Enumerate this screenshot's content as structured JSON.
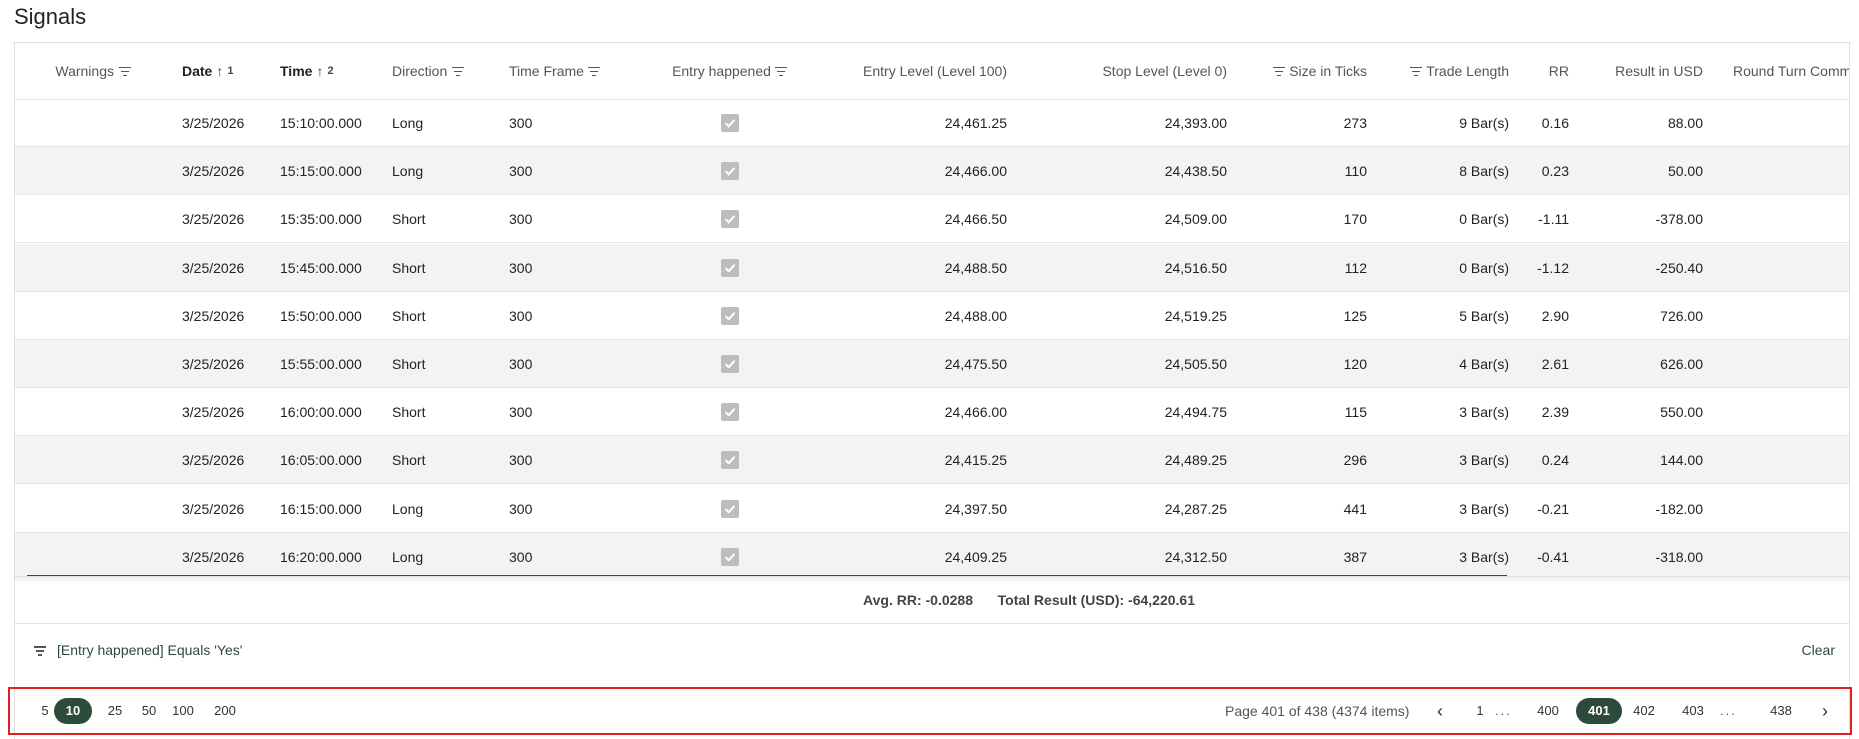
{
  "title": "Signals",
  "columns": {
    "warnings": "Warnings",
    "date": "Date",
    "date_sort_index": "1",
    "time": "Time",
    "time_sort_index": "2",
    "direction": "Direction",
    "time_frame": "Time Frame",
    "entry_happened": "Entry happened",
    "entry_level": "Entry Level (Level 100)",
    "stop_level": "Stop Level (Level 0)",
    "size_in_ticks": "Size in Ticks",
    "trade_length": "Trade Length",
    "rr": "RR",
    "result_usd": "Result in USD",
    "round_turn": "Round Turn Comm"
  },
  "rows": [
    {
      "date": "3/25/2026",
      "time": "15:10:00.000",
      "direction": "Long",
      "time_frame": "300",
      "entry": "24,461.25",
      "stop": "24,393.00",
      "ticks": "273",
      "length": "9 Bar(s)",
      "rr": "0.16",
      "result": "88.00"
    },
    {
      "date": "3/25/2026",
      "time": "15:15:00.000",
      "direction": "Long",
      "time_frame": "300",
      "entry": "24,466.00",
      "stop": "24,438.50",
      "ticks": "110",
      "length": "8 Bar(s)",
      "rr": "0.23",
      "result": "50.00"
    },
    {
      "date": "3/25/2026",
      "time": "15:35:00.000",
      "direction": "Short",
      "time_frame": "300",
      "entry": "24,466.50",
      "stop": "24,509.00",
      "ticks": "170",
      "length": "0 Bar(s)",
      "rr": "-1.11",
      "result": "-378.00"
    },
    {
      "date": "3/25/2026",
      "time": "15:45:00.000",
      "direction": "Short",
      "time_frame": "300",
      "entry": "24,488.50",
      "stop": "24,516.50",
      "ticks": "112",
      "length": "0 Bar(s)",
      "rr": "-1.12",
      "result": "-250.40"
    },
    {
      "date": "3/25/2026",
      "time": "15:50:00.000",
      "direction": "Short",
      "time_frame": "300",
      "entry": "24,488.00",
      "stop": "24,519.25",
      "ticks": "125",
      "length": "5 Bar(s)",
      "rr": "2.90",
      "result": "726.00"
    },
    {
      "date": "3/25/2026",
      "time": "15:55:00.000",
      "direction": "Short",
      "time_frame": "300",
      "entry": "24,475.50",
      "stop": "24,505.50",
      "ticks": "120",
      "length": "4 Bar(s)",
      "rr": "2.61",
      "result": "626.00"
    },
    {
      "date": "3/25/2026",
      "time": "16:00:00.000",
      "direction": "Short",
      "time_frame": "300",
      "entry": "24,466.00",
      "stop": "24,494.75",
      "ticks": "115",
      "length": "3 Bar(s)",
      "rr": "2.39",
      "result": "550.00"
    },
    {
      "date": "3/25/2026",
      "time": "16:05:00.000",
      "direction": "Short",
      "time_frame": "300",
      "entry": "24,415.25",
      "stop": "24,489.25",
      "ticks": "296",
      "length": "3 Bar(s)",
      "rr": "0.24",
      "result": "144.00"
    },
    {
      "date": "3/25/2026",
      "time": "16:15:00.000",
      "direction": "Long",
      "time_frame": "300",
      "entry": "24,397.50",
      "stop": "24,287.25",
      "ticks": "441",
      "length": "3 Bar(s)",
      "rr": "-0.21",
      "result": "-182.00"
    },
    {
      "date": "3/25/2026",
      "time": "16:20:00.000",
      "direction": "Long",
      "time_frame": "300",
      "entry": "24,409.25",
      "stop": "24,312.50",
      "ticks": "387",
      "length": "3 Bar(s)",
      "rr": "-0.41",
      "result": "-318.00"
    }
  ],
  "totals": {
    "avg_rr": "Avg. RR: -0.0288",
    "total_result": "Total Result (USD): -64,220.61"
  },
  "filter": {
    "text": "[Entry happened] Equals 'Yes'",
    "clear_label": "Clear"
  },
  "pager": {
    "page_sizes": [
      "5",
      "10",
      "25",
      "50",
      "100",
      "200"
    ],
    "active_page_size": "10",
    "info": "Page 401 of 438 (4374 items)",
    "pages": [
      "1",
      "...",
      "400",
      "401",
      "402",
      "403",
      "...",
      "438"
    ],
    "active_page": "401"
  },
  "colors": {
    "accent": "#2e4a3a",
    "highlight_border": "#e02020"
  }
}
